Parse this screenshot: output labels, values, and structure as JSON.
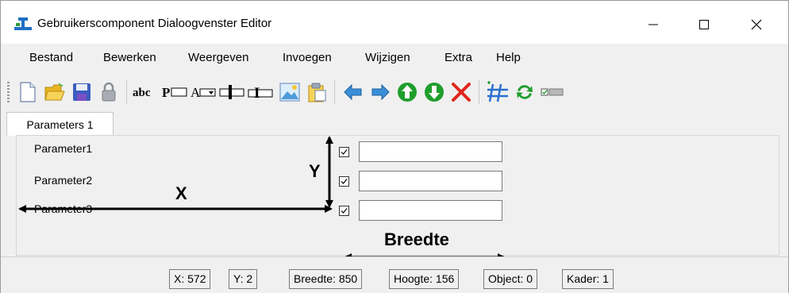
{
  "window": {
    "title": "Gebruikerscomponent Dialoogvenster Editor",
    "icons": [
      "app-icon",
      "minimize-icon",
      "maximize-icon",
      "close-icon"
    ]
  },
  "menu": [
    "Bestand",
    "Bewerken",
    "Weergeven",
    "Invoegen",
    "Wijzigen",
    "Extra",
    "Help"
  ],
  "toolbar": {
    "icons": [
      "new-document-icon",
      "open-folder-icon",
      "save-icon",
      "lock-icon",
      "text-label-icon",
      "text-field-icon",
      "dropdown-field-icon",
      "slider-field-icon",
      "text-cursor-field-icon",
      "image-icon",
      "paste-icon",
      "arrow-left-icon",
      "arrow-right-icon",
      "arrow-up-icon",
      "arrow-down-icon",
      "delete-icon",
      "grid-icon",
      "refresh-icon",
      "checkbox-toggle-icon"
    ],
    "text_icons": {
      "text_label": "abc",
      "text_field": "P",
      "dropdown_field": "A",
      "text_cursor_field": "I"
    }
  },
  "tabs": [
    {
      "label": "Parameters 1"
    }
  ],
  "parameters": [
    {
      "label": "Parameter1",
      "checked": true,
      "value": ""
    },
    {
      "label": "Parameter2",
      "checked": true,
      "value": ""
    },
    {
      "label": "Parameter3",
      "checked": true,
      "value": ""
    }
  ],
  "annotations": {
    "x": "X",
    "y": "Y",
    "width": "Breedte"
  },
  "status": {
    "x": "X: 572",
    "y": "Y: 2",
    "width": "Breedte: 850",
    "height": "Hoogte: 156",
    "object": "Object: 0",
    "frame": "Kader: 1"
  },
  "colors": {
    "arrow_blue": "#3a8fd8",
    "arrow_green": "#1f9e2c",
    "delete_red": "#e2261b",
    "save_blue": "#3a5dbf",
    "folder_yellow": "#f4c430"
  }
}
